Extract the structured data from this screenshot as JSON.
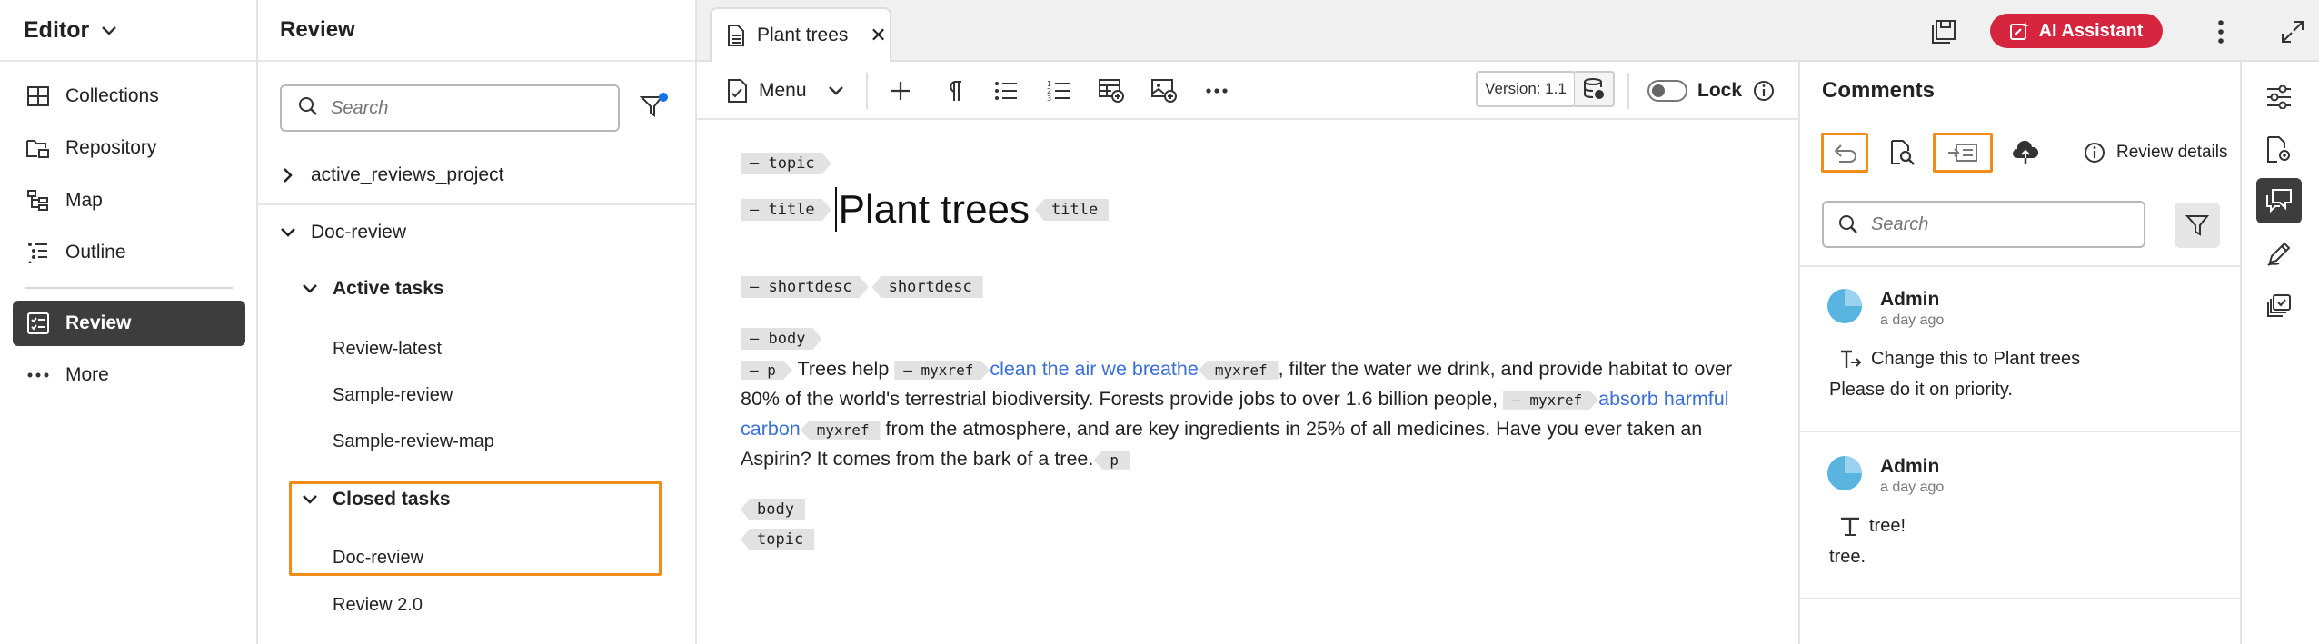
{
  "leftnav": {
    "title": "Editor",
    "items": [
      {
        "label": "Collections"
      },
      {
        "label": "Repository"
      },
      {
        "label": "Map"
      },
      {
        "label": "Outline"
      },
      {
        "label": "Review"
      },
      {
        "label": "More"
      }
    ]
  },
  "review": {
    "title": "Review",
    "search_placeholder": "Search",
    "tree": {
      "project": "active_reviews_project",
      "folder": "Doc-review",
      "active_group": "Active tasks",
      "active_tasks": [
        "Review-latest",
        "Sample-review",
        "Sample-review-map"
      ],
      "closed_group": "Closed tasks",
      "closed_tasks": [
        "Doc-review",
        "Review 2.0"
      ]
    }
  },
  "tabbar": {
    "tab_label": "Plant trees",
    "ai_label": "AI Assistant"
  },
  "toolbar": {
    "menu_label": "Menu",
    "version": "Version: 1.1",
    "lock_label": "Lock"
  },
  "document": {
    "tag_topic": "topic",
    "tag_title": "title",
    "title_text": "Plant trees",
    "tag_shortdesc": "shortdesc",
    "tag_body": "body",
    "tag_p": "p",
    "tag_myxref": "myxref",
    "p_text_1": "Trees help",
    "p_link_1": "clean the air we breathe",
    "p_text_2": ", filter the water we drink, and provide habitat to over 80% of the world's terrestrial biodiversity. Forests provide jobs to over 1.6 billion people,",
    "p_link_2": "absorb harmful carbon",
    "p_text_3": "from the atmosphere, and are key ingredients in 25% of all medicines. Have you ever taken an Aspirin? It comes from the bark of a tree."
  },
  "comments": {
    "title": "Comments",
    "review_details": "Review details",
    "search_placeholder": "Search",
    "items": [
      {
        "author": "Admin",
        "time": "a day ago",
        "action": "Change this to Plant trees",
        "text": "Please do it on priority."
      },
      {
        "author": "Admin",
        "time": "a day ago",
        "action": "tree!",
        "text": "tree."
      }
    ]
  },
  "colors": {
    "accent_highlight": "#f08c1a",
    "ai_button": "#d6253e",
    "link": "#3a6fd8",
    "active_nav": "#3d3d3d"
  },
  "icons": {
    "nav": [
      "collections-icon",
      "repository-icon",
      "map-icon",
      "outline-icon",
      "review-icon",
      "more-icon"
    ],
    "toolbar": [
      "document-icon",
      "add-icon",
      "paragraph-icon",
      "bulleted-list-icon",
      "numbered-list-icon",
      "insert-table-icon",
      "insert-image-icon",
      "more-options-icon"
    ],
    "comments": [
      "undo-icon",
      "search-document-icon",
      "insert-comment-icon",
      "cloud-upload-icon",
      "info-icon"
    ],
    "rail": [
      "properties-icon",
      "file-settings-icon",
      "comments-icon",
      "edit-icon",
      "versions-icon"
    ]
  }
}
